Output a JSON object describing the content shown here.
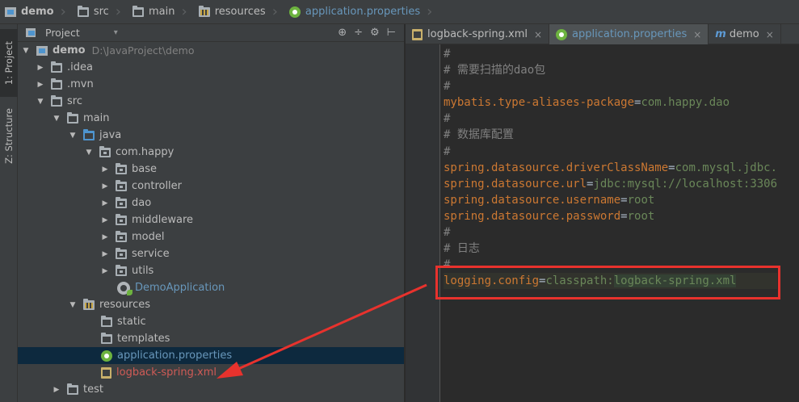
{
  "breadcrumb": [
    "demo",
    "src",
    "main",
    "resources",
    "application.properties"
  ],
  "toolstrip": {
    "project_tab": "1: Project",
    "structure_tab": "Z: Structure"
  },
  "project_panel": {
    "title": "Project",
    "dropdown": "▾",
    "tools": [
      "⊕",
      "÷",
      "⚙",
      "⊢"
    ]
  },
  "tree": {
    "root": {
      "name": "demo",
      "path": "D:\\JavaProject\\demo"
    },
    "idea": ".idea",
    "mvn": ".mvn",
    "src": "src",
    "main": "main",
    "java": "java",
    "package": "com.happy",
    "subpackages": [
      "base",
      "controller",
      "dao",
      "middleware",
      "model",
      "service",
      "utils"
    ],
    "app_class": "DemoApplication",
    "resources": "resources",
    "static": "static",
    "templates": "templates",
    "app_props": "application.properties",
    "logback": "logback-spring.xml",
    "test": "test"
  },
  "editor_tabs": [
    {
      "label": "logback-spring.xml",
      "close": "×"
    },
    {
      "label": "application.properties",
      "close": "×"
    },
    {
      "label": "demo",
      "close": "×"
    }
  ],
  "code": {
    "l1": "#",
    "l2": "# 需要扫描的dao包",
    "l3": "#",
    "l4_key": "mybatis.type-aliases-package",
    "l4_eq": "=",
    "l4_val": "com.happy.dao",
    "l5": "#",
    "l6": "# 数据库配置",
    "l7": "#",
    "l8_key": "spring.datasource.driverClassName",
    "l8_eq": "=",
    "l8_val": "com.mysql.jdbc.",
    "l9_key": "spring.datasource.url",
    "l9_eq": "=",
    "l9_val": "jdbc:mysql://localhost:3306",
    "l10_key": "spring.datasource.username",
    "l10_eq": "=",
    "l10_val": "root",
    "l11_key": "spring.datasource.password",
    "l11_eq": "=",
    "l11_val": "root",
    "l12": "#",
    "l13": "# 日志",
    "l14": "#",
    "l15_key": "logging.config",
    "l15_eq": "=",
    "l15_val_a": "classpath:",
    "l15_val_b": "logback-spring.xml"
  },
  "colors": {
    "annotation_red": "#e8322d",
    "key": "#cc7832",
    "value": "#6a8759",
    "comment": "#808080"
  }
}
